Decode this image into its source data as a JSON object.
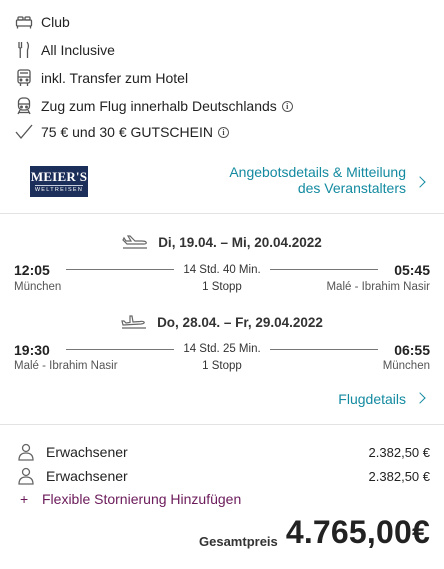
{
  "features": [
    {
      "icon": "bed-icon",
      "label": "Club"
    },
    {
      "icon": "cutlery-icon",
      "label": "All Inclusive"
    },
    {
      "icon": "bus-icon",
      "label": "inkl. Transfer zum Hotel"
    },
    {
      "icon": "train-icon",
      "label": "Zug zum Flug innerhalb Deutschlands",
      "info": true
    },
    {
      "icon": "checkmark-icon",
      "label": "75 € und 30 € GUTSCHEIN",
      "info": true
    }
  ],
  "operator": {
    "logo_line1": "MEIER'S",
    "logo_line2": "WELTREISEN",
    "details_link_line1": "Angebotsdetails & Mitteilung",
    "details_link_line2": "des Veranstalters"
  },
  "outbound": {
    "dates": "Di, 19.04. – Mi, 20.04.2022",
    "dep_time": "12:05",
    "dep_place": "München",
    "duration": "14 Std. 40 Min.",
    "stops": "1 Stopp",
    "arr_time": "05:45",
    "arr_place": "Malé - Ibrahim Nasir"
  },
  "inbound": {
    "dates": "Do, 28.04. – Fr, 29.04.2022",
    "dep_time": "19:30",
    "dep_place": "Malé - Ibrahim Nasir",
    "duration": "14 Std. 25 Min.",
    "stops": "1 Stopp",
    "arr_time": "06:55",
    "arr_place": "München"
  },
  "flight_details_link": "Flugdetails",
  "passengers": [
    {
      "label": "Erwachsener",
      "price": "2.382,50 €"
    },
    {
      "label": "Erwachsener",
      "price": "2.382,50 €"
    }
  ],
  "addon": {
    "plus": "+",
    "label": "Flexible Stornierung Hinzufügen"
  },
  "total": {
    "label": "Gesamtpreis",
    "value": "4.765,00€"
  },
  "colors": {
    "link": "#138aa0",
    "addon": "#6b1a5a",
    "logo_bg": "#1c2e5a"
  }
}
